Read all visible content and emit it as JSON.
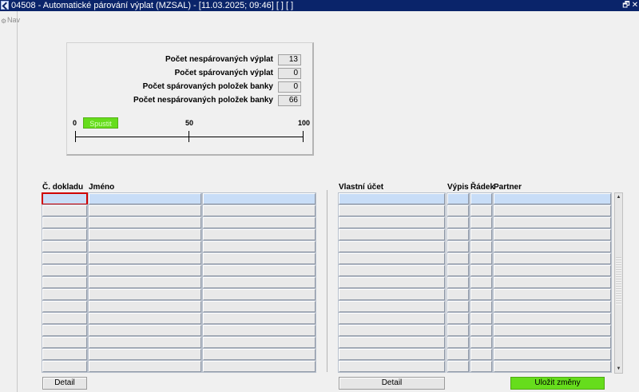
{
  "window": {
    "title": "04508 - Automatické párování výplat (MZSAL) - [11.03.2025; 09:46]  [ ]  [ ]",
    "restore_glyph": "🗗",
    "close_glyph": "✕",
    "icon": "app-icon"
  },
  "nav": {
    "label": "Nav",
    "icon": "nav-icon"
  },
  "stats": [
    {
      "label": "Počet nespárovaných výplat",
      "value": "13"
    },
    {
      "label": "Počet spárovaných výplat",
      "value": "0"
    },
    {
      "label": "Počet spárovaných položek banky",
      "value": "0"
    },
    {
      "label": "Počet nespárovaných položek banky",
      "value": "66"
    }
  ],
  "progress": {
    "ticks": [
      "0",
      "50",
      "100"
    ],
    "button_label": "Spustit",
    "button_color": "#66dd1c"
  },
  "left_table": {
    "columns": [
      "Č. dokladu",
      "Jméno",
      ""
    ],
    "row_count": 15,
    "detail_label": "Detail"
  },
  "right_table": {
    "columns": [
      "Vlastní účet",
      "Výpis",
      "Řádek",
      "Partner"
    ],
    "row_count": 15,
    "detail_label": "Detail"
  },
  "save_label": "Uložit změny",
  "colors": {
    "selected_row": "#c8ddf7",
    "accent_green": "#66dd1c",
    "title_bar": "#0a246a",
    "focus": "#d00000"
  }
}
